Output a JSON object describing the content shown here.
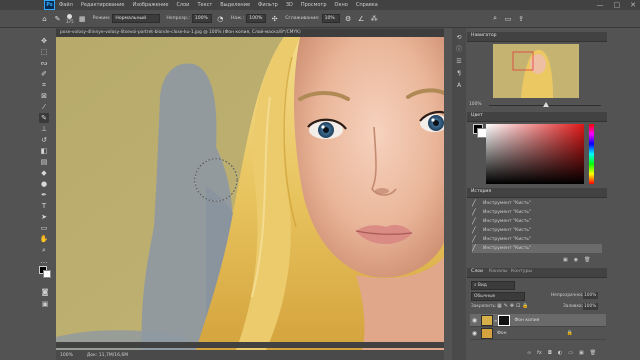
{
  "menu": {
    "logo": "Ps",
    "items": [
      "Файл",
      "Редактирование",
      "Изображение",
      "Слои",
      "Текст",
      "Выделение",
      "Фильтр",
      "3D",
      "Просмотр",
      "Окно",
      "Справка"
    ]
  },
  "window_controls": {
    "minimize": "—",
    "maximize": "□",
    "close": "✕"
  },
  "options_bar": {
    "brush_size": "375",
    "mode_label": "Режим:",
    "mode_value": "Нормальный",
    "opacity_label": "Непрозр.:",
    "opacity_value": "100%",
    "flow_label": "Наж.:",
    "flow_value": "100%",
    "smoothing_label": "Сглаживание:",
    "smoothing_value": "10%"
  },
  "document": {
    "tab_title": "pose-volosy-dlinnye-volosy-litsevoi-portret-blonde-close-ku-1.jpg @ 100% (Фон копия, Слой-маска/8*/CMYK)",
    "zoom": "100%",
    "doc_info": "Док: 11,7М/16,6М"
  },
  "tools": [
    "move-tool",
    "marquee-tool",
    "lasso-tool",
    "quick-select-tool",
    "crop-tool",
    "frame-tool",
    "eyedropper-tool",
    "healing-tool",
    "brush-tool",
    "clone-stamp-tool",
    "history-brush-tool",
    "eraser-tool",
    "gradient-tool",
    "blur-tool",
    "dodge-tool",
    "pen-tool",
    "type-tool",
    "path-select-tool",
    "shape-tool",
    "hand-tool",
    "zoom-tool",
    "more-tools"
  ],
  "navigator": {
    "title": "Навигатор",
    "zoom": "100%"
  },
  "color": {
    "title": "Цвет"
  },
  "history": {
    "title": "История",
    "items": [
      "Инструмент \"Кисть\"",
      "Инструмент \"Кисть\"",
      "Инструмент \"Кисть\"",
      "Инструмент \"Кисть\"",
      "Инструмент \"Кисть\"",
      "Инструмент \"Кисть\""
    ],
    "active_index": 5
  },
  "layers": {
    "tabs": [
      "Слои",
      "Каналы",
      "Контуры"
    ],
    "filter": "Вид",
    "blend_mode": "Обычные",
    "opacity_label": "Непрозрачность:",
    "opacity_value": "100%",
    "lock_label": "Закрепить:",
    "fill_label": "Заливка:",
    "fill_value": "100%",
    "items": [
      {
        "name": "Фон копия",
        "visible": true,
        "has_mask": true
      },
      {
        "name": "Фон",
        "visible": true,
        "has_mask": false
      }
    ]
  },
  "colors": {
    "menubar": "#424242",
    "panel": "#535353",
    "accent": "#31a8ff",
    "background_yellow": "#bcae6c",
    "background_gray": "#8a94a0"
  }
}
